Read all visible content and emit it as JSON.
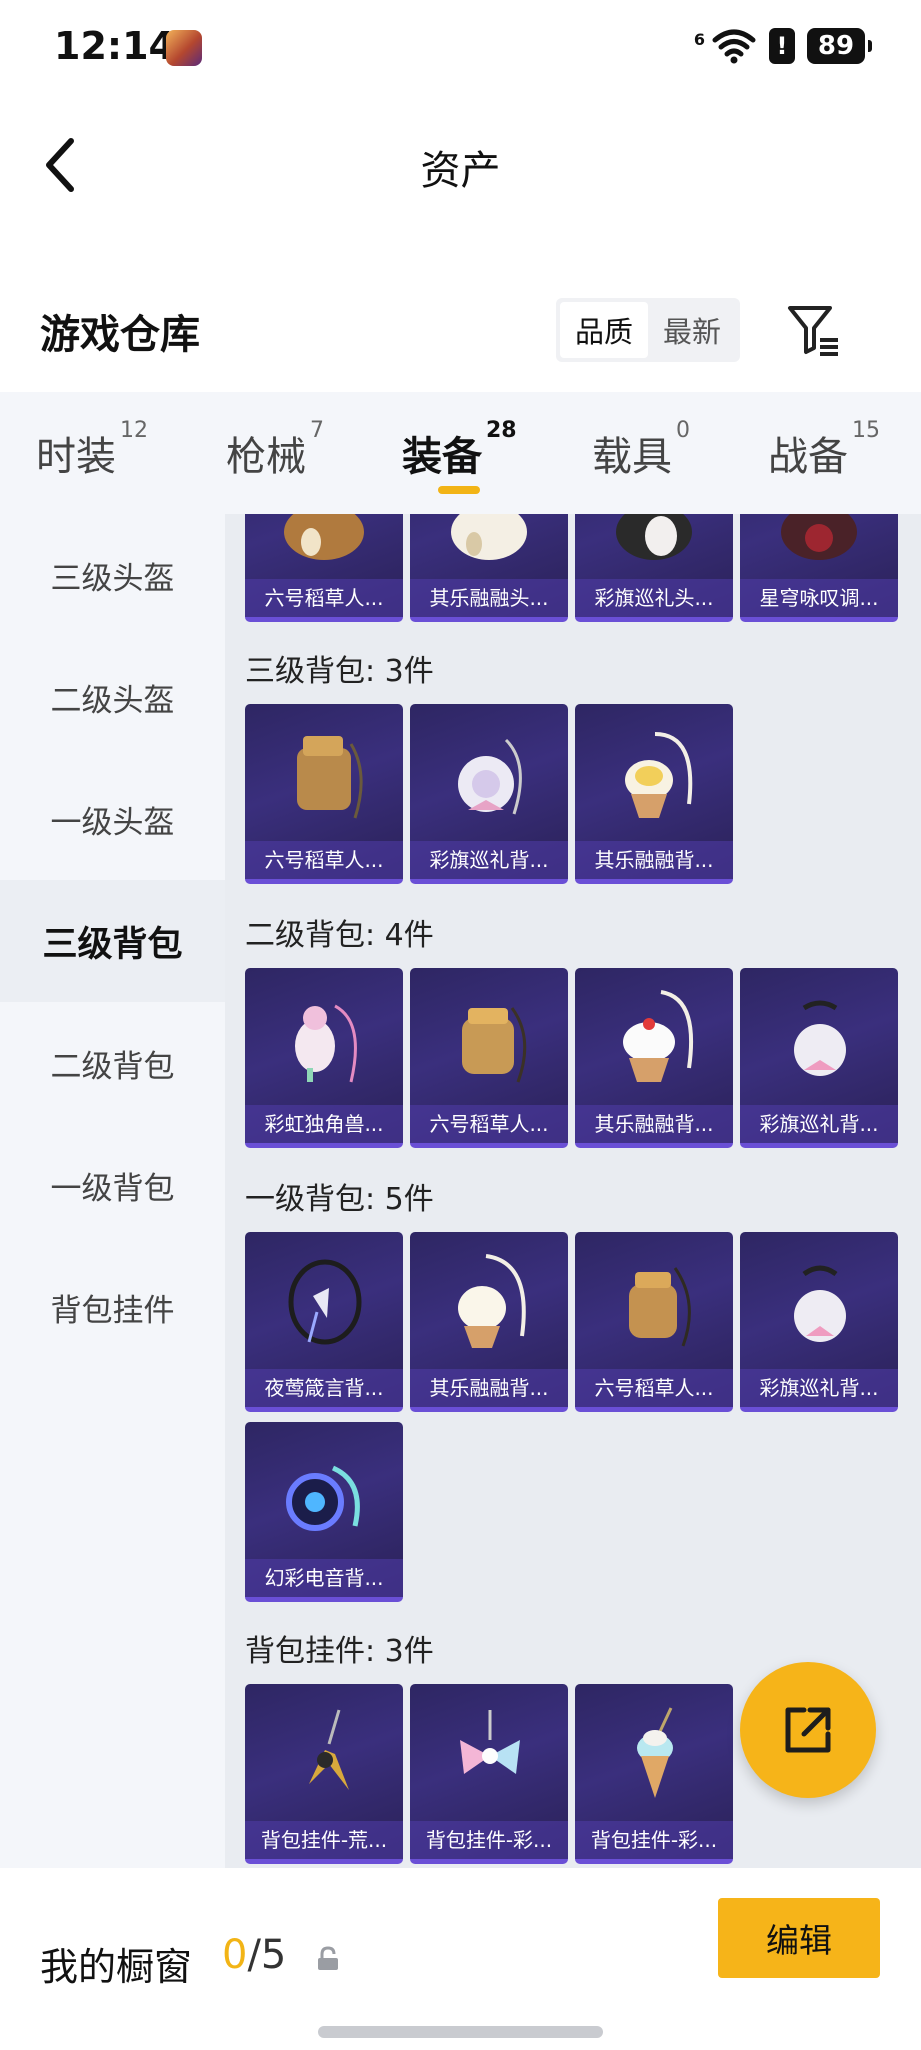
{
  "status_bar": {
    "time": "12:14",
    "network": "6",
    "battery": "89"
  },
  "header": {
    "title": "资产"
  },
  "section": {
    "title": "游戏仓库",
    "sort_options": [
      "品质",
      "最新"
    ],
    "active_sort": "品质"
  },
  "tabs": [
    {
      "label": "时装",
      "count": "12"
    },
    {
      "label": "枪械",
      "count": "7"
    },
    {
      "label": "装备",
      "count": "28",
      "active": true
    },
    {
      "label": "载具",
      "count": "0"
    },
    {
      "label": "战备",
      "count": "15"
    }
  ],
  "sidebar": {
    "items": [
      "三级头盔",
      "二级头盔",
      "一级头盔",
      "三级背包",
      "二级背包",
      "一级背包",
      "背包挂件"
    ],
    "active": "三级背包"
  },
  "groups": [
    {
      "title": "",
      "items": [
        "六号稻草人...",
        "其乐融融头...",
        "彩旗巡礼头...",
        "星穹咏叹调..."
      ]
    },
    {
      "title": "三级背包: 3件",
      "items": [
        "六号稻草人...",
        "彩旗巡礼背...",
        "其乐融融背..."
      ]
    },
    {
      "title": "二级背包: 4件",
      "items": [
        "彩虹独角兽...",
        "六号稻草人...",
        "其乐融融背...",
        "彩旗巡礼背..."
      ]
    },
    {
      "title": "一级背包: 5件",
      "items": [
        "夜莺箴言背...",
        "其乐融融背...",
        "六号稻草人...",
        "彩旗巡礼背...",
        "幻彩电音背..."
      ]
    },
    {
      "title": "背包挂件: 3件",
      "items": [
        "背包挂件-荒...",
        "背包挂件-彩...",
        "背包挂件-彩..."
      ]
    }
  ],
  "bottom": {
    "title": "我的橱窗",
    "current": "0",
    "total": "/5",
    "edit_label": "编辑"
  },
  "colors": {
    "accent": "#f6b419",
    "card_bg": "#2e2663",
    "card_border": "#6a4fd6"
  }
}
